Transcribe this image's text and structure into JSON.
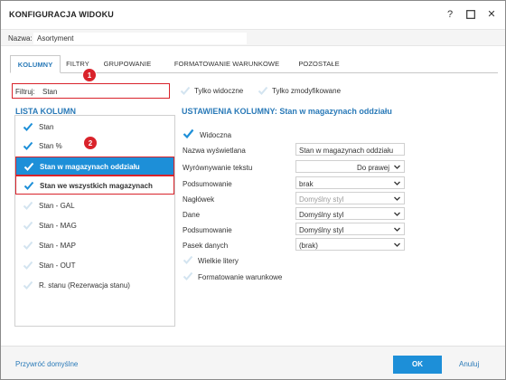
{
  "window": {
    "title": "KONFIGURACJA WIDOKU",
    "help_icon": "question-mark-icon",
    "help_symbol": "?",
    "maximize_icon": "maximize-icon",
    "close_icon": "close-icon",
    "close_symbol": "✕"
  },
  "name_field": {
    "label": "Nazwa:",
    "value": "Asortyment"
  },
  "tabs": [
    {
      "label": "KOLUMNY",
      "active": true
    },
    {
      "label": "FILTRY",
      "active": false
    },
    {
      "label": "GRUPOWANIE",
      "active": false
    },
    {
      "label": "FORMATOWANIE WARUNKOWE",
      "active": false
    },
    {
      "label": "POZOSTAŁE",
      "active": false
    }
  ],
  "filter": {
    "label": "Filtruj:",
    "value": "Stan"
  },
  "top_options": [
    {
      "label": "Tylko widoczne",
      "checked": false
    },
    {
      "label": "Tylko zmodyfikowane",
      "checked": false
    }
  ],
  "column_list": {
    "title": "LISTA KOLUMN",
    "items": [
      {
        "label": "Stan",
        "checked": true,
        "state": "normal"
      },
      {
        "label": "Stan %",
        "checked": true,
        "state": "normal"
      },
      {
        "label": "Stan w magazynach oddziału",
        "checked": true,
        "state": "selected"
      },
      {
        "label": "Stan we wszystkich magazynach",
        "checked": true,
        "state": "outlined"
      },
      {
        "label": "Stan - GAL",
        "checked": false,
        "state": "normal"
      },
      {
        "label": "Stan - MAG",
        "checked": false,
        "state": "normal"
      },
      {
        "label": "Stan - MAP",
        "checked": false,
        "state": "normal"
      },
      {
        "label": "Stan - OUT",
        "checked": false,
        "state": "normal"
      },
      {
        "label": "R. stanu (Rezerwacja stanu)",
        "checked": false,
        "state": "normal"
      }
    ]
  },
  "settings": {
    "title": "USTAWIENIA KOLUMNY: Stan w magazynach oddziału",
    "visible": {
      "label": "Widoczna",
      "checked": true
    },
    "properties": [
      {
        "label": "Nazwa wyświetlana",
        "type": "text",
        "value": "Stan w magazynach oddziału"
      },
      {
        "label": "Wyrównywanie tekstu",
        "type": "select",
        "value": "Do prawej",
        "align": "right"
      },
      {
        "label": "Podsumowanie",
        "type": "select",
        "value": "brak"
      },
      {
        "label": "Nagłówek",
        "type": "select",
        "value": "Domyślny styl",
        "disabled": true
      },
      {
        "label": "Dane",
        "type": "select",
        "value": "Domyślny styl"
      },
      {
        "label": "Podsumowanie",
        "type": "select",
        "value": "Domyślny styl"
      },
      {
        "label": "Pasek danych",
        "type": "select",
        "value": "(brak)"
      }
    ],
    "checkboxes": [
      {
        "label": "Wielkie litery",
        "checked": false
      },
      {
        "label": "Formatowanie warunkowe",
        "checked": false
      }
    ]
  },
  "annotations": [
    {
      "number": "1"
    },
    {
      "number": "2"
    }
  ],
  "footer": {
    "restore_label": "Przywróć domyślne",
    "ok_label": "OK",
    "cancel_label": "Anuluj"
  },
  "colors": {
    "accent": "#1d8fd8",
    "title_blue": "#2a7ab8",
    "highlight_red": "#d9232b"
  }
}
